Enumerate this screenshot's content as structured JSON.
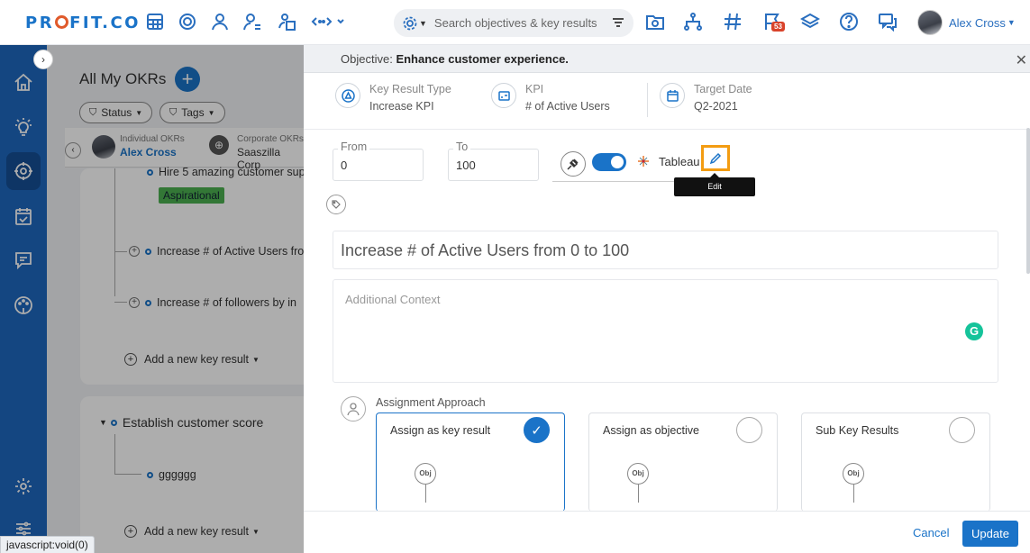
{
  "app": {
    "logo_text": "PROFIT.CO",
    "user_name": "Alex Cross",
    "notification_count": "53",
    "search_placeholder": "Search objectives & key results",
    "status_link": "javascript:void(0)"
  },
  "icons": {
    "topbar": [
      "dashboard-grid-icon",
      "target-icon",
      "people-icon",
      "person-target-icon",
      "building-person-icon",
      "more-code-icon",
      "goal-folder-icon",
      "hierarchy-icon",
      "hash-icon",
      "flag-notify-icon",
      "layers-icon",
      "help-icon",
      "chat-icon"
    ],
    "sidebar": [
      "home-icon",
      "bulb-icon",
      "target-icon",
      "calendar-check-icon",
      "message-icon",
      "palette-icon",
      "settings-icon",
      "sliders-icon"
    ]
  },
  "background": {
    "title": "All My OKRs",
    "filters": [
      "Status",
      "Tags"
    ],
    "tabs": [
      {
        "small": "Individual OKRs",
        "big": "Alex Cross"
      },
      {
        "small": "Corporate OKRs",
        "big": "Saaszilla Corp"
      }
    ],
    "kr_items": [
      "Hire 5 amazing customer sup",
      "Increase # of Active Users fro",
      "Increase # of followers by in"
    ],
    "aspirational_tag": "Aspirational",
    "add_kr_label": "Add a new key result",
    "objective2": "Establish customer score",
    "objective2_kr": "gggggg"
  },
  "modal": {
    "objective_prefix": "Objective:",
    "objective_name": "Enhance customer experience.",
    "meta": [
      {
        "label": "Key Result Type",
        "value": "Increase KPI",
        "icon": "triangle-icon"
      },
      {
        "label": "KPI",
        "value": "# of Active Users",
        "icon": "kpi-icon"
      },
      {
        "label": "Target Date",
        "value": "Q2-2021",
        "icon": "calendar-icon"
      }
    ],
    "from_label": "From",
    "from_value": "0",
    "to_label": "To",
    "to_value": "100",
    "integration_label": "Tableau",
    "edit_tooltip": "Edit",
    "kr_title": "Increase # of Active Users from 0 to 100",
    "context_placeholder": "Additional Context",
    "assignment_label": "Assignment Approach",
    "options": [
      {
        "label": "Assign as key result",
        "selected": true
      },
      {
        "label": "Assign as objective",
        "selected": false
      },
      {
        "label": "Sub Key Results",
        "selected": false
      }
    ],
    "obj_bubble": "Obj",
    "cancel_label": "Cancel",
    "update_label": "Update"
  },
  "colors": {
    "brand": "#1a73c8",
    "sidebar": "#1e67bf",
    "highlight": "#f39c12",
    "aspirational": "#4cb050"
  }
}
